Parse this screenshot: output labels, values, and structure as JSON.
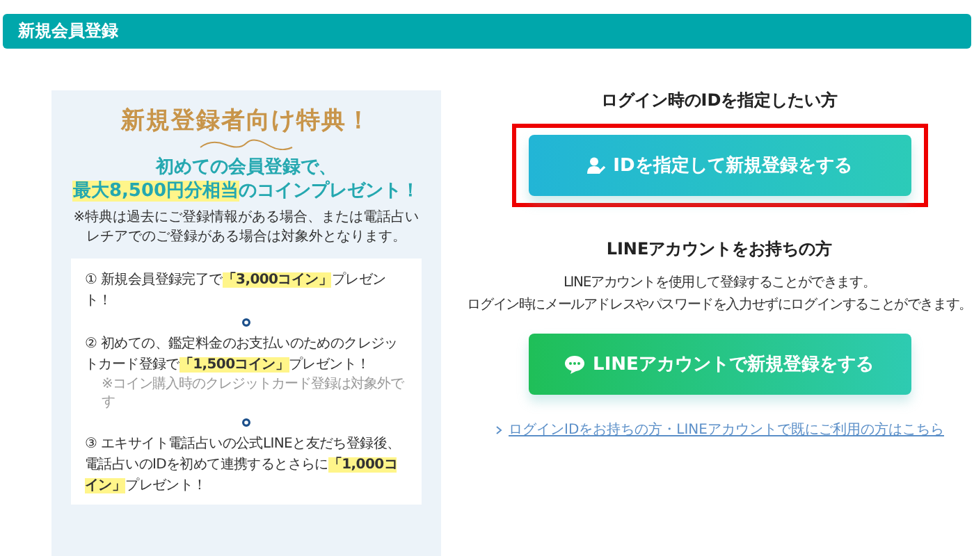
{
  "header": {
    "title": "新規会員登録"
  },
  "benefits": {
    "title": "新規登録者向け特典！",
    "headline": "初めての会員登録で、",
    "headline_highlight": "最大8,500円分相当",
    "headline_rest": "のコインプレゼント！",
    "note": "※特典は過去にご登録情報がある場合、または電話占いレチアでのご登録がある場合は対象外となります。",
    "items": [
      {
        "number": "①",
        "before": "新規会員登録完了で",
        "highlight": "「3,000コイン」",
        "after": "プレゼント！"
      },
      {
        "number": "②",
        "before": "初めての、鑑定料金のお支払いのためのクレジットカード登録で",
        "highlight": "「1,500コイン」",
        "after": "プレゼント！",
        "note": "※コイン購入時のクレジットカード登録は対象外です"
      },
      {
        "number": "③",
        "before": "エキサイト電話占いの公式LINEと友だち登録後、電話占いのIDを初めて連携するとさらに",
        "highlight": "「1,000コイン」",
        "after": "プレゼント！"
      }
    ]
  },
  "register": {
    "id_heading": "ログイン時のIDを指定したい方",
    "id_button": {
      "label": "IDを指定して新規登録をする",
      "highlighted": true
    },
    "line_heading": "LINEアカウントをお持ちの方",
    "line_description": [
      "LINEアカウントを使用して登録することができます。",
      "ログイン時にメールアドレスやパスワードを入力せずにログインすることができます。"
    ],
    "line_button": {
      "label": "LINEアカウントで新規登録をする",
      "highlighted": false
    },
    "login_link": "ログインIDをお持ちの方・LINEアカウントで既にご利用の方はこちら"
  }
}
